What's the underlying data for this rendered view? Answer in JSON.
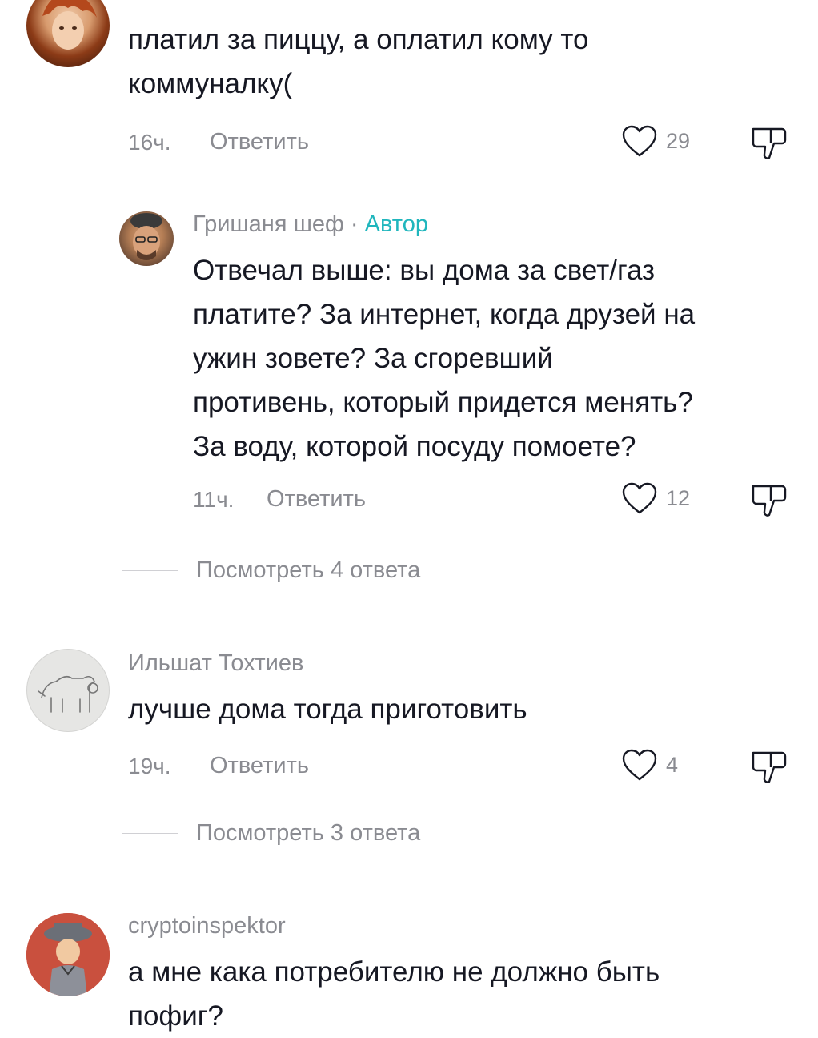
{
  "comments": [
    {
      "text_lines": [
        "платил за пиццу, а оплатил кому то",
        "коммуналку("
      ],
      "time": "16ч.",
      "reply_label": "Ответить",
      "likes": "29"
    },
    {
      "author": "Гришаня шеф",
      "separator": "·",
      "badge": "Автор",
      "text_lines": [
        "Отвечал выше: вы дома за свет/газ",
        "платите? За интернет, когда друзей на",
        "ужин зовете? За сгоревший",
        "противень, который придется менять?",
        "За воду, которой посуду помоете?"
      ],
      "time": "11ч.",
      "reply_label": "Ответить",
      "likes": "12",
      "view_replies": "Посмотреть 4 ответа"
    },
    {
      "author": "Ильшат Тохтиев",
      "text_lines": [
        "лучше дома тогда приготовить"
      ],
      "time": "19ч.",
      "reply_label": "Ответить",
      "likes": "4",
      "view_replies": "Посмотреть 3 ответа"
    },
    {
      "author": "cryptoinspektor",
      "text_lines": [
        "а мне кака потребителю не должно быть",
        "пофиг?"
      ]
    }
  ],
  "icons": {
    "like": "heart-outline-icon",
    "dislike": "thumb-down-outline-icon"
  },
  "colors": {
    "text": "#161823",
    "muted": "#8a8b91",
    "author_badge": "#20b6bd"
  }
}
